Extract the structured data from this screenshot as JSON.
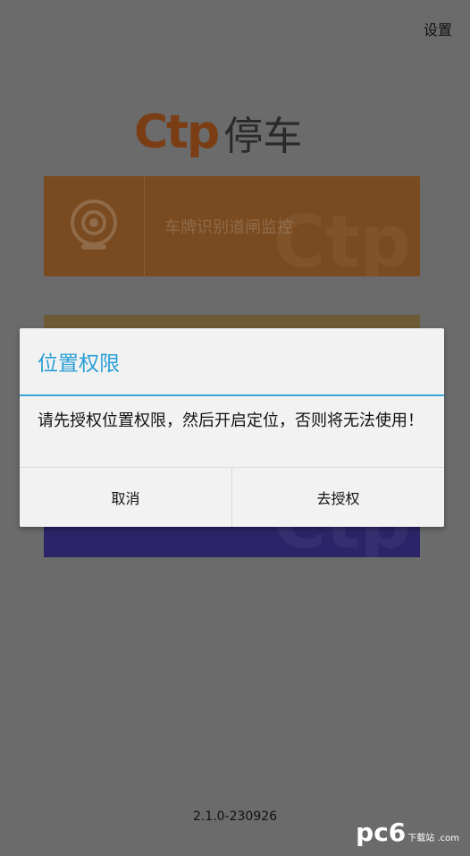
{
  "header": {
    "settings_label": "设置"
  },
  "logo": {
    "mark": "Ctp",
    "text": "停车"
  },
  "cards": [
    {
      "label": "车牌识别道闸监控",
      "icon": "camera-icon"
    }
  ],
  "dialog": {
    "title": "位置权限",
    "message": "请先授权位置权限，然后开启定位，否则将无法使用！",
    "cancel_label": "取消",
    "confirm_label": "去授权"
  },
  "footer": {
    "version": "2.1.0-230926"
  },
  "watermark": {
    "main": "pc6",
    "sub": "下载站 .com"
  },
  "colors": {
    "accent": "#2a9fd6",
    "card_orange": "#e07a20",
    "card_purple": "#3a2aa8"
  }
}
